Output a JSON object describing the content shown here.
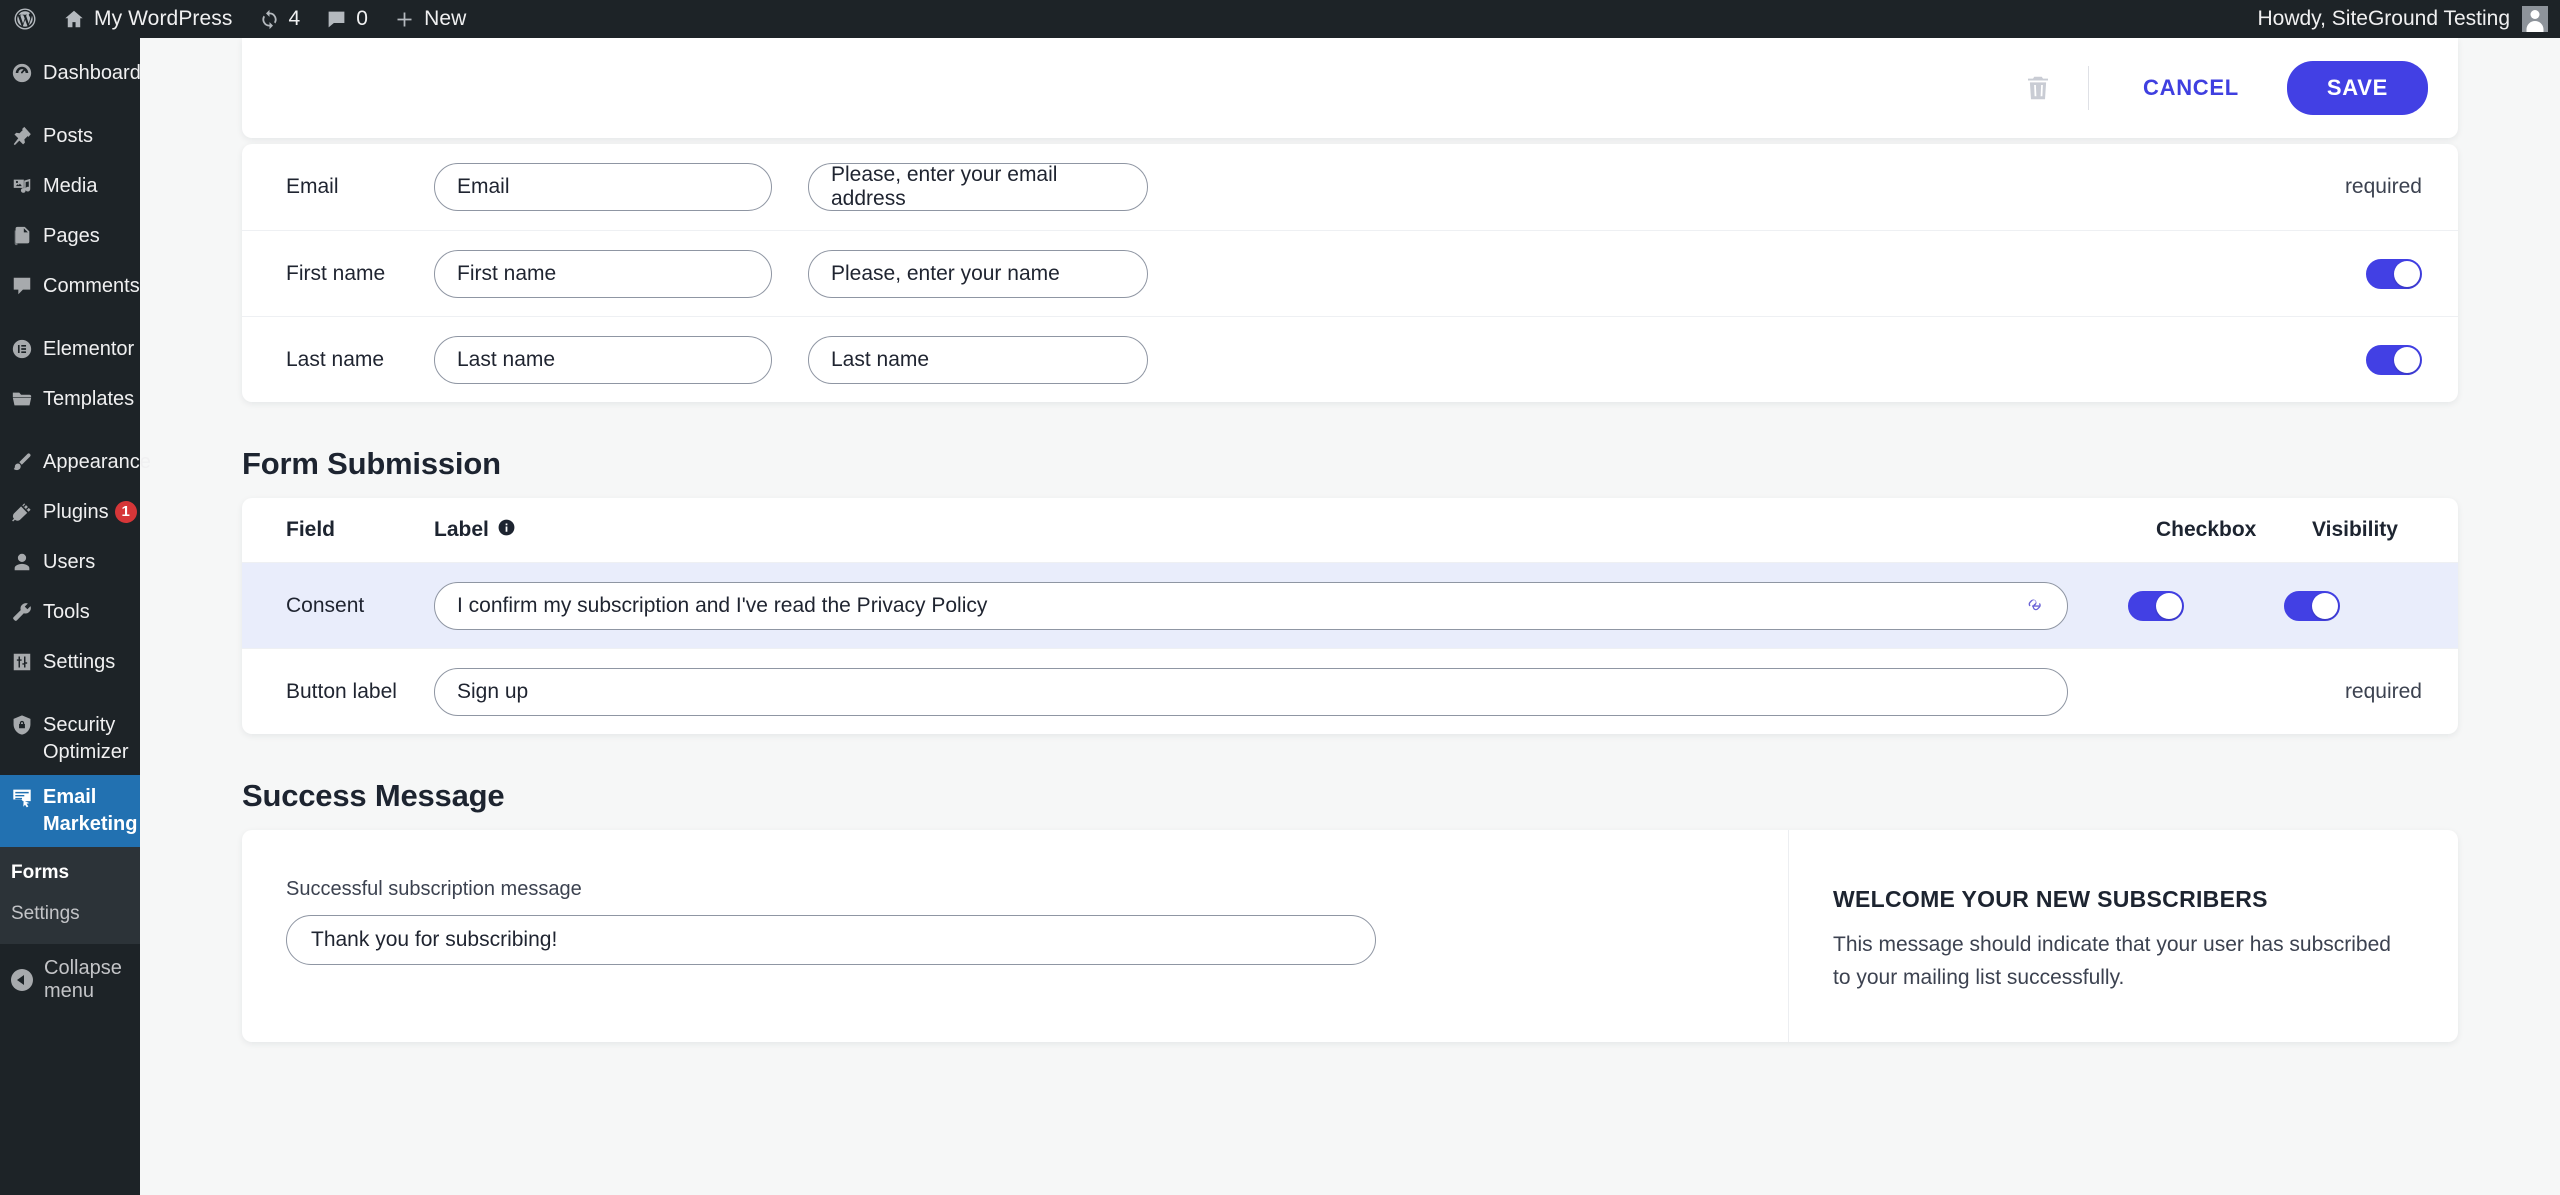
{
  "adminbar": {
    "logo_icon": "wordpress-logo-icon",
    "site_name": "My WordPress",
    "updates_icon": "updates-icon",
    "updates_count": "4",
    "comments_icon": "comments-icon",
    "comments_count": "0",
    "new_icon": "plus-icon",
    "new_label": "New",
    "howdy": "Howdy, SiteGround Testing",
    "avatar_icon": "user-avatar-icon"
  },
  "sidebar": {
    "items": [
      {
        "label": "Dashboard",
        "icon": "dashboard-icon",
        "sep_after": true
      },
      {
        "label": "Posts",
        "icon": "pin-icon"
      },
      {
        "label": "Media",
        "icon": "media-icon"
      },
      {
        "label": "Pages",
        "icon": "pages-icon"
      },
      {
        "label": "Comments",
        "icon": "comment-bubble-icon",
        "sep_after": true
      },
      {
        "label": "Elementor",
        "icon": "elementor-icon"
      },
      {
        "label": "Templates",
        "icon": "folder-icon",
        "sep_after": true
      },
      {
        "label": "Appearance",
        "icon": "paintbrush-icon"
      },
      {
        "label": "Plugins",
        "icon": "plug-icon",
        "badge": "1"
      },
      {
        "label": "Users",
        "icon": "user-icon"
      },
      {
        "label": "Tools",
        "icon": "wrench-icon"
      },
      {
        "label": "Settings",
        "icon": "settings-sliders-icon",
        "sep_after": true
      },
      {
        "label": "Security Optimizer",
        "icon": "shield-gear-icon"
      },
      {
        "label": "Email Marketing",
        "icon": "email-marketing-icon",
        "current": true
      }
    ],
    "submenu": [
      {
        "label": "Forms",
        "current": true
      },
      {
        "label": "Settings",
        "current": false
      }
    ],
    "collapse_label": "Collapse menu",
    "collapse_icon": "collapse-arrow-icon"
  },
  "toolbar": {
    "delete_icon": "trash-icon",
    "cancel_label": "CANCEL",
    "save_label": "SAVE"
  },
  "form_fields": {
    "rows": [
      {
        "name": "Email",
        "label_value": "Email",
        "placeholder_value": "Please, enter your email address",
        "tail_type": "text",
        "tail_text": "required"
      },
      {
        "name": "First name",
        "label_value": "First name",
        "placeholder_value": "Please, enter your name",
        "tail_type": "toggle",
        "toggle_on": true
      },
      {
        "name": "Last name",
        "label_value": "Last name",
        "placeholder_value": "Last name",
        "tail_type": "toggle",
        "toggle_on": true
      }
    ]
  },
  "form_submission": {
    "heading": "Form Submission",
    "columns": {
      "field": "Field",
      "label": "Label",
      "label_info_icon": "info-icon",
      "checkbox": "Checkbox",
      "visibility": "Visibility"
    },
    "consent": {
      "field": "Consent",
      "value": "I confirm my subscription and I've read the Privacy Policy",
      "link_icon": "link-icon",
      "checkbox_on": true,
      "visibility_on": true
    },
    "button_label": {
      "field": "Button label",
      "value": "Sign up",
      "tail_text": "required"
    }
  },
  "success_message": {
    "heading": "Success Message",
    "input_label": "Successful subscription message",
    "input_value": "Thank you for subscribing!",
    "info_title": "WELCOME YOUR NEW SUBSCRIBERS",
    "info_text": "This message should indicate that your user has subscribed to your mailing list successfully."
  },
  "colors": {
    "accent": "#4240e4",
    "admin_dark": "#1d2327",
    "menu_current": "#2271b1",
    "badge_red": "#d63638",
    "row_highlight": "#e9edfb"
  }
}
